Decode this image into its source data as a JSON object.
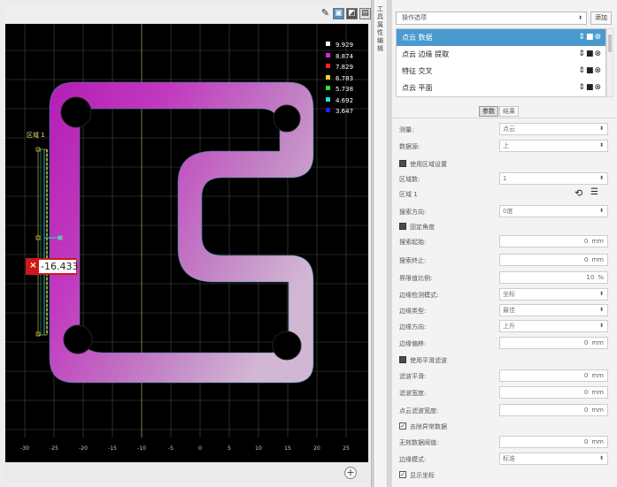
{
  "toolbar": {
    "icons": [
      "wand-icon",
      "fit-view-icon",
      "view-mode-icon",
      "layout-icon"
    ]
  },
  "legend": [
    {
      "value": "9.929",
      "color": "#ffffff"
    },
    {
      "value": "8.874",
      "color": "#e020e0"
    },
    {
      "value": "7.829",
      "color": "#ff2020"
    },
    {
      "value": "6.783",
      "color": "#ffd020"
    },
    {
      "value": "5.738",
      "color": "#30e030"
    },
    {
      "value": "4.692",
      "color": "#20e0e0"
    },
    {
      "value": "3.647",
      "color": "#2020ff"
    }
  ],
  "region_label": "区域 1",
  "measurement": {
    "value": "-16.433",
    "close": "×"
  },
  "x_ticks": [
    "-30",
    "-25",
    "-20",
    "-15",
    "-10",
    "-5",
    "0",
    "5",
    "10",
    "15",
    "20",
    "25",
    "30",
    "35"
  ],
  "zoom": "+",
  "side_tab": "工具属性编辑",
  "panel": {
    "ops_select": "操作选项",
    "add_label": "添加",
    "operations": [
      {
        "label": "点云 数据",
        "selected": true
      },
      {
        "label": "点云 边缘 提取",
        "selected": false
      },
      {
        "label": "特征 交叉",
        "selected": false
      },
      {
        "label": "点云 平面",
        "selected": false
      }
    ],
    "op_icons": "⇕■⊗",
    "tabs": {
      "params": "参数",
      "results": "结果"
    },
    "fields": {
      "mode_label": "测量:",
      "mode_value": "点云",
      "source_label": "数据源:",
      "source_value": "上",
      "use_region_label": "使用区域设置",
      "count_label": "区域数:",
      "count_value": "1",
      "region1_label": "区域 1",
      "direction_label": "搜索方向:",
      "direction_value": "0度",
      "fixed_angle_label": "固定角度",
      "search_start_label": "搜索起始:",
      "search_start_value": "0",
      "search_end_label": "搜索终止:",
      "search_end_value": "0",
      "boundary_label": "界限值比例:",
      "boundary_value": "10",
      "edge_detect_label": "边缘检测模式:",
      "edge_detect_value": "坐标",
      "edge_type_label": "边缘类型:",
      "edge_type_value": "最佳",
      "edge_dir_label": "边缘方向:",
      "edge_dir_value": "上升",
      "offset_label": "边缘偏移:",
      "offset_value": "0",
      "use_smooth_label": "使用平滑滤波",
      "smooth_mode_label": "滤波平滑:",
      "smooth_mode_value": "0",
      "width_label": "滤波宽度:",
      "width_value": "0",
      "filter_label": "点云滤波宽度:",
      "filter_value": "0",
      "outlier_label": "去除异常数据",
      "invalid_label": "无效数据阈值:",
      "invalid_value": "0",
      "edge_mode_label": "边缘模式:",
      "edge_mode_value": "标准",
      "show_label": "显示坐标"
    },
    "units": {
      "mm": "mm",
      "percent": "%"
    }
  }
}
